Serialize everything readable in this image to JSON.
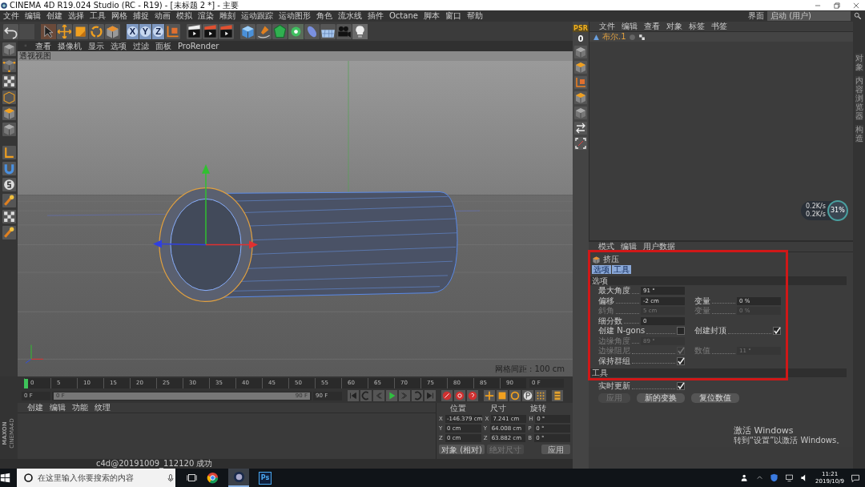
{
  "window": {
    "title": "CINEMA 4D R19.024 Studio (RC - R19) - [未标题 2 *] - 主要"
  },
  "menu": [
    "文件",
    "编辑",
    "创建",
    "选择",
    "工具",
    "网格",
    "捕捉",
    "动画",
    "模拟",
    "渲染",
    "雕刻",
    "运动跟踪",
    "运动图形",
    "角色",
    "流水线",
    "插件",
    "Octane",
    "脚本",
    "窗口",
    "帮助"
  ],
  "layout": {
    "label": "界面",
    "value": "启动 (用户)"
  },
  "toolbar": {
    "axis_buttons": [
      {
        "label": "X",
        "selected": true
      },
      {
        "label": "Y",
        "selected": true
      },
      {
        "label": "Z",
        "selected": true
      }
    ]
  },
  "viewport": {
    "menu": [
      "查看",
      "摄像机",
      "显示",
      "选项",
      "过滤",
      "面板",
      "ProRender"
    ],
    "label": "透视视图",
    "grid_spacing": "网格间距 : 100 cm"
  },
  "psr": {
    "label": "PSR",
    "value": "0"
  },
  "object_manager": {
    "menu": [
      "文件",
      "编辑",
      "查看",
      "对象",
      "标签",
      "书签"
    ],
    "objects": [
      {
        "name": "布尔.1"
      }
    ]
  },
  "side_tabs": [
    "对象",
    "内容浏览器",
    "构造"
  ],
  "net_monitor": {
    "upload": "0.2K/s",
    "download": "0.2K/s",
    "percent": "31%"
  },
  "attributes": {
    "menu": [
      "模式",
      "编辑",
      "用户数据"
    ],
    "tool": "挤压",
    "tabs": [
      {
        "label": "选项",
        "selected": true
      },
      {
        "label": "工具",
        "selected": true
      }
    ],
    "sections": [
      {
        "title": "选项",
        "rows": [
          [
            {
              "kind": "field",
              "label": "最大角度",
              "value": "91 °",
              "disabled": false
            }
          ],
          [
            {
              "kind": "field",
              "label": "偏移",
              "value": "-2 cm",
              "disabled": false
            },
            {
              "kind": "field",
              "label": "变量",
              "value": "0 %",
              "disabled": false
            }
          ],
          [
            {
              "kind": "field",
              "label": "斜角",
              "value": "5 cm",
              "disabled": true
            },
            {
              "kind": "field",
              "label": "变量",
              "value": "0 %",
              "disabled": true
            }
          ],
          [
            {
              "kind": "field",
              "label": "细分数",
              "value": "0",
              "disabled": false
            }
          ],
          [
            {
              "kind": "checkbox",
              "label": "创建 N-gons",
              "checked": false,
              "disabled": false
            },
            {
              "kind": "checkbox",
              "label": "创建封顶",
              "checked": true,
              "disabled": false
            }
          ],
          [
            {
              "kind": "field",
              "label": "边缘角度",
              "value": "89 °",
              "disabled": true
            }
          ],
          [
            {
              "kind": "checkbox",
              "label": "边缘阻尼",
              "checked": true,
              "disabled": true
            },
            {
              "kind": "field",
              "label": "数值",
              "value": "11 °",
              "disabled": true
            }
          ],
          [
            {
              "kind": "checkbox",
              "label": "保持群组",
              "checked": true,
              "disabled": false
            }
          ]
        ]
      },
      {
        "title": "工具",
        "rows": [
          [
            {
              "kind": "checkbox",
              "label": "实时更新",
              "checked": true,
              "disabled": false
            }
          ],
          [
            {
              "kind": "button",
              "label": "应用",
              "disabled": true
            },
            {
              "kind": "button",
              "label": "新的变换",
              "disabled": false
            },
            {
              "kind": "button",
              "label": "复位数值",
              "disabled": false
            }
          ]
        ]
      }
    ]
  },
  "timeline": {
    "ticks": [
      "0",
      "5",
      "10",
      "15",
      "20",
      "25",
      "30",
      "35",
      "40",
      "45",
      "50",
      "55",
      "60",
      "65",
      "70",
      "75",
      "80",
      "85",
      "90"
    ],
    "playhead": {
      "level": 0
    },
    "range": {
      "level": 1
    },
    "current": "0 F",
    "start": "0 F",
    "range_start": "0 F",
    "range_end": "90 F",
    "end": "90 F"
  },
  "material_manager": {
    "menu": [
      "创建",
      "编辑",
      "功能",
      "纹理"
    ]
  },
  "coordinates": {
    "headers": [
      "位置",
      "尺寸",
      "旋转"
    ],
    "rows": [
      {
        "axis": "X",
        "position": "-146.379 cm",
        "size_axis": "X",
        "size": "7.241 cm",
        "rot_axis": "H",
        "rotation": "0 °"
      },
      {
        "axis": "Y",
        "position": "0 cm",
        "size_axis": "Y",
        "size": "64.008 cm",
        "rot_axis": "P",
        "rotation": "0 °"
      },
      {
        "axis": "Z",
        "position": "0 cm",
        "size_axis": "Z",
        "size": "63.882 cm",
        "rot_axis": "B",
        "rotation": "0 °"
      }
    ],
    "mode": "对象 (相对)",
    "size_mode": "绝对尺寸",
    "apply": "应用"
  },
  "logo": {
    "brand": "MAXON",
    "product": "CINEMA4D"
  },
  "status_bar": "c4d@20191009_112120 成功",
  "activation": {
    "title": "激活 Windows",
    "hint": "转到“设置”以激活 Windows。"
  },
  "taskbar": {
    "search": {
      "placeholder": "在这里输入你要搜索的内容"
    },
    "app_label": "Ps",
    "time": "11:21",
    "date": "2019/10/9"
  }
}
